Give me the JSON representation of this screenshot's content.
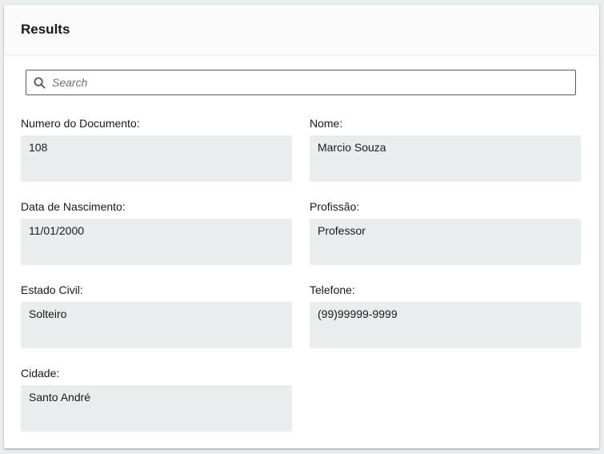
{
  "panel": {
    "title": "Results"
  },
  "search": {
    "placeholder": "Search",
    "value": ""
  },
  "fields": [
    {
      "label": "Numero do Documento:",
      "value": "108"
    },
    {
      "label": "Nome:",
      "value": "Marcio Souza"
    },
    {
      "label": "Data de Nascimento:",
      "value": "11/01/2000"
    },
    {
      "label": "Profissão:",
      "value": "Professor"
    },
    {
      "label": "Estado Civil:",
      "value": "Solteiro"
    },
    {
      "label": "Telefone:",
      "value": "(99)99999-9999"
    },
    {
      "label": "Cidade:",
      "value": "Santo André"
    }
  ],
  "colors": {
    "panel_background": "#ffffff",
    "header_background": "#fafafa",
    "field_background": "#eaeded",
    "text": "#16191f",
    "placeholder": "#687078",
    "search_border": "#545b64"
  },
  "icons": {
    "search": "search-icon"
  }
}
